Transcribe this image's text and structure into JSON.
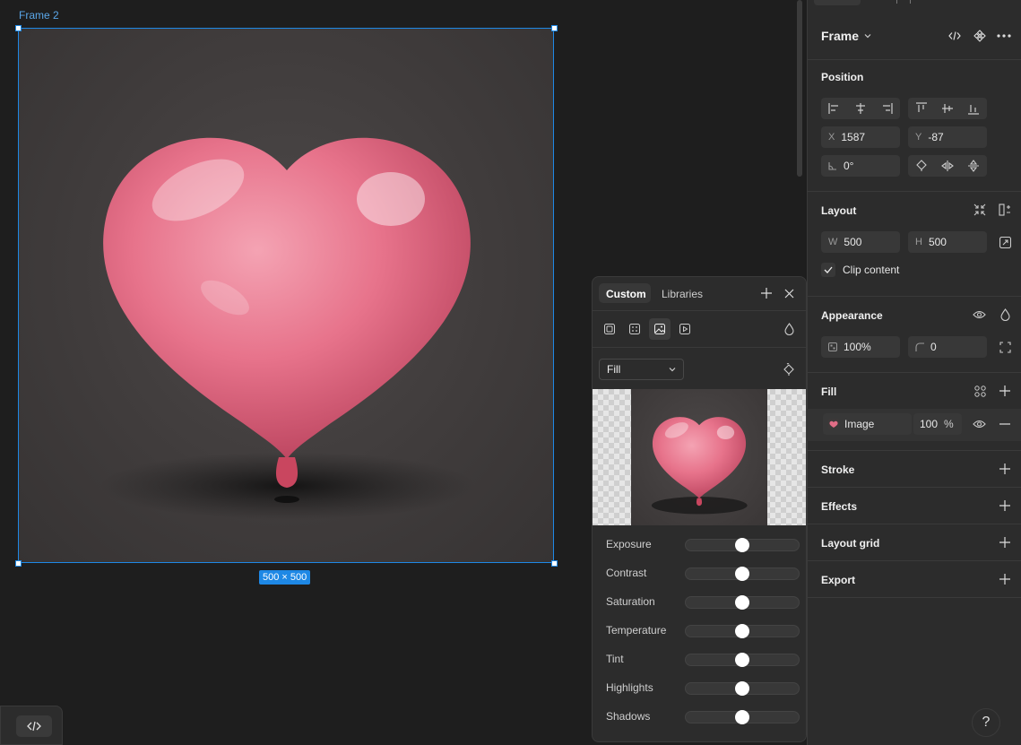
{
  "canvas": {
    "frame_label": "Frame 2",
    "size_badge": "500 × 500"
  },
  "panel": {
    "title": "Frame",
    "position": {
      "title": "Position",
      "x_label": "X",
      "x_value": "1587",
      "y_label": "Y",
      "y_value": "-87",
      "rotation_value": "0°"
    },
    "layout": {
      "title": "Layout",
      "w_label": "W",
      "w_value": "500",
      "h_label": "H",
      "h_value": "500",
      "clip_content": "Clip content"
    },
    "appearance": {
      "title": "Appearance",
      "opacity": "100%",
      "radius": "0"
    },
    "fill": {
      "title": "Fill",
      "type": "Image",
      "opacity": "100",
      "opacity_unit": "%"
    },
    "stroke": {
      "title": "Stroke"
    },
    "effects": {
      "title": "Effects"
    },
    "layout_grid": {
      "title": "Layout grid"
    },
    "export": {
      "title": "Export"
    }
  },
  "popover": {
    "tabs": [
      "Custom",
      "Libraries"
    ],
    "fill_mode": "Fill",
    "adjustments": [
      {
        "label": "Exposure",
        "value": 0
      },
      {
        "label": "Contrast",
        "value": 0
      },
      {
        "label": "Saturation",
        "value": 0
      },
      {
        "label": "Temperature",
        "value": 0
      },
      {
        "label": "Tint",
        "value": 0
      },
      {
        "label": "Highlights",
        "value": 0
      },
      {
        "label": "Shadows",
        "value": 0
      }
    ]
  },
  "help": {
    "label": "?"
  },
  "colors": {
    "selection": "#1e88e5",
    "heart": "#e26d86",
    "panel_bg": "#2c2c2c"
  }
}
